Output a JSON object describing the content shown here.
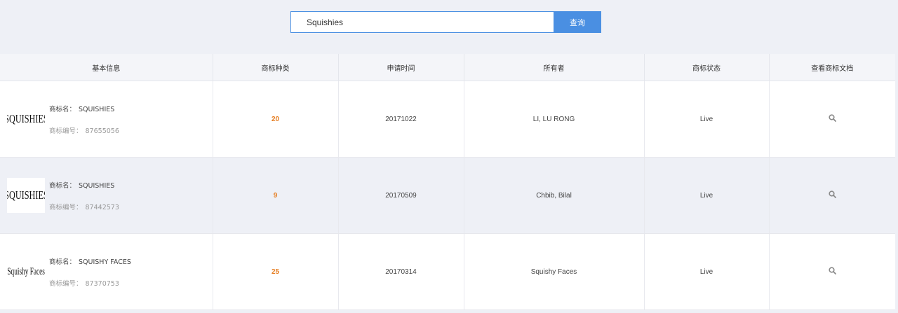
{
  "search": {
    "value": "Squishies",
    "button_label": "查询"
  },
  "table": {
    "headers": [
      "基本信息",
      "商标种类",
      "申请时间",
      "所有者",
      "商标状态",
      "查看商标文档"
    ],
    "name_label": "商标名：",
    "number_label": "商标编号：",
    "rows": [
      {
        "logo_text": "SQUISHIES",
        "name": "SQUISHIES",
        "number": "87655056",
        "class": "20",
        "date": "20171022",
        "owner": "LI, LU RONG",
        "status": "Live"
      },
      {
        "logo_text": "SQUISHIES",
        "name": "SQUISHIES",
        "number": "87442573",
        "class": "9",
        "date": "20170509",
        "owner": "Chbib, Bilal",
        "status": "Live"
      },
      {
        "logo_text": "Squishy Faces",
        "name": "SQUISHY FACES",
        "number": "87370753",
        "class": "25",
        "date": "20170314",
        "owner": "Squishy Faces",
        "status": "Live"
      }
    ]
  },
  "colors": {
    "accent": "#4a8fe2",
    "class_number": "#e67e22",
    "page_background": "#eef0f6"
  },
  "icons": {
    "doc_view": "search-icon"
  }
}
